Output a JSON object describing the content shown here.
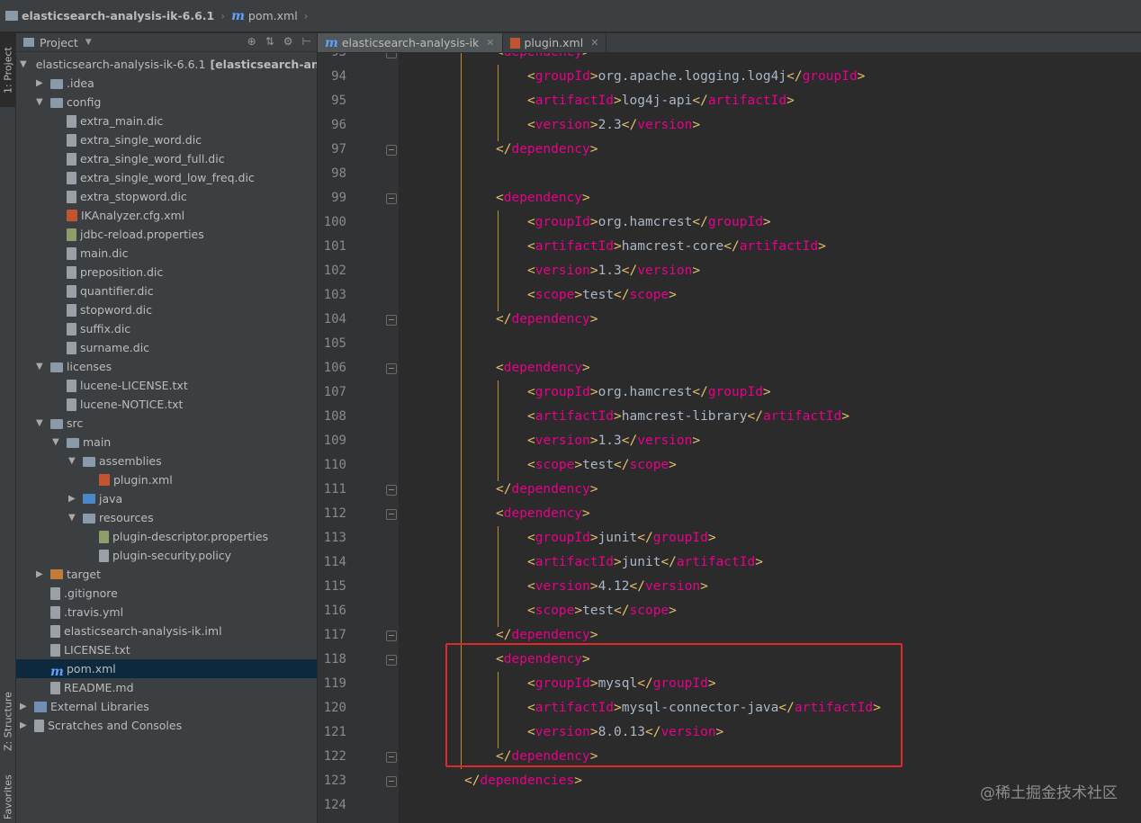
{
  "breadcrumb": {
    "project": "elasticsearch-analysis-ik-6.6.1",
    "file": "pom.xml"
  },
  "left_strip": {
    "project_tab": "1: Project",
    "structure_tab": "Z: Structure",
    "favorites_tab": "Favorites"
  },
  "project_panel": {
    "title": "Project",
    "items": [
      {
        "label": "elasticsearch-analysis-ik-6.6.1",
        "extra": "[elasticsearch-analy",
        "icon": "folder-icon",
        "arrow": "down"
      },
      {
        "label": ".idea",
        "icon": "folder-icon",
        "arrow": "right"
      },
      {
        "label": "config",
        "icon": "folder-icon",
        "arrow": "down"
      },
      {
        "label": "extra_main.dic",
        "icon": "file-icon",
        "arrow": ""
      },
      {
        "label": "extra_single_word.dic",
        "icon": "file-icon",
        "arrow": ""
      },
      {
        "label": "extra_single_word_full.dic",
        "icon": "file-icon",
        "arrow": ""
      },
      {
        "label": "extra_single_word_low_freq.dic",
        "icon": "file-icon",
        "arrow": ""
      },
      {
        "label": "extra_stopword.dic",
        "icon": "file-icon",
        "arrow": ""
      },
      {
        "label": "IKAnalyzer.cfg.xml",
        "icon": "xml-icon",
        "arrow": ""
      },
      {
        "label": "jdbc-reload.properties",
        "icon": "properties-icon",
        "arrow": ""
      },
      {
        "label": "main.dic",
        "icon": "file-icon",
        "arrow": ""
      },
      {
        "label": "preposition.dic",
        "icon": "file-icon",
        "arrow": ""
      },
      {
        "label": "quantifier.dic",
        "icon": "file-icon",
        "arrow": ""
      },
      {
        "label": "stopword.dic",
        "icon": "file-icon",
        "arrow": ""
      },
      {
        "label": "suffix.dic",
        "icon": "file-icon",
        "arrow": ""
      },
      {
        "label": "surname.dic",
        "icon": "file-icon",
        "arrow": ""
      },
      {
        "label": "licenses",
        "icon": "folder-icon",
        "arrow": "down"
      },
      {
        "label": "lucene-LICENSE.txt",
        "icon": "file-icon",
        "arrow": ""
      },
      {
        "label": "lucene-NOTICE.txt",
        "icon": "file-icon",
        "arrow": ""
      },
      {
        "label": "src",
        "icon": "folder-icon",
        "arrow": "down"
      },
      {
        "label": "main",
        "icon": "folder-icon",
        "arrow": "down"
      },
      {
        "label": "assemblies",
        "icon": "folder-icon",
        "arrow": "down"
      },
      {
        "label": "plugin.xml",
        "icon": "xml-icon",
        "arrow": ""
      },
      {
        "label": "java",
        "icon": "source-folder-icon",
        "arrow": "right"
      },
      {
        "label": "resources",
        "icon": "resources-folder-icon",
        "arrow": "down"
      },
      {
        "label": "plugin-descriptor.properties",
        "icon": "properties-icon",
        "arrow": ""
      },
      {
        "label": "plugin-security.policy",
        "icon": "file-icon",
        "arrow": ""
      },
      {
        "label": "target",
        "icon": "excluded-folder-icon",
        "arrow": "right"
      },
      {
        "label": ".gitignore",
        "icon": "file-icon",
        "arrow": ""
      },
      {
        "label": ".travis.yml",
        "icon": "file-icon",
        "arrow": ""
      },
      {
        "label": "elasticsearch-analysis-ik.iml",
        "icon": "file-icon",
        "arrow": ""
      },
      {
        "label": "LICENSE.txt",
        "icon": "file-icon",
        "arrow": ""
      },
      {
        "label": "pom.xml",
        "icon": "maven-icon",
        "arrow": "",
        "selected": true
      },
      {
        "label": "README.md",
        "icon": "file-icon",
        "arrow": ""
      },
      {
        "label": "External Libraries",
        "icon": "library-icon",
        "arrow": "right"
      },
      {
        "label": "Scratches and Consoles",
        "icon": "scratches-icon",
        "arrow": "right"
      }
    ]
  },
  "tabs": [
    {
      "label": "elasticsearch-analysis-ik",
      "icon": "maven-icon",
      "active": true
    },
    {
      "label": "plugin.xml",
      "icon": "xml-icon",
      "active": false
    }
  ],
  "editor": {
    "lines": [
      {
        "n": "93",
        "indent": 4,
        "tag": "dependency",
        "kind": "open-partial"
      },
      {
        "n": "94",
        "indent": 6,
        "tag": "groupId",
        "value": "org.apache.logging.log4j"
      },
      {
        "n": "95",
        "indent": 6,
        "tag": "artifactId",
        "value": "log4j-api"
      },
      {
        "n": "96",
        "indent": 6,
        "tag": "version",
        "value": "2.3"
      },
      {
        "n": "97",
        "indent": 4,
        "tag": "dependency",
        "kind": "close"
      },
      {
        "n": "98",
        "kind": "blank"
      },
      {
        "n": "99",
        "indent": 4,
        "tag": "dependency",
        "kind": "open"
      },
      {
        "n": "100",
        "indent": 6,
        "tag": "groupId",
        "value": "org.hamcrest"
      },
      {
        "n": "101",
        "indent": 6,
        "tag": "artifactId",
        "value": "hamcrest-core"
      },
      {
        "n": "102",
        "indent": 6,
        "tag": "version",
        "value": "1.3"
      },
      {
        "n": "103",
        "indent": 6,
        "tag": "scope",
        "value": "test"
      },
      {
        "n": "104",
        "indent": 4,
        "tag": "dependency",
        "kind": "close"
      },
      {
        "n": "105",
        "kind": "blank"
      },
      {
        "n": "106",
        "indent": 4,
        "tag": "dependency",
        "kind": "open"
      },
      {
        "n": "107",
        "indent": 6,
        "tag": "groupId",
        "value": "org.hamcrest"
      },
      {
        "n": "108",
        "indent": 6,
        "tag": "artifactId",
        "value": "hamcrest-library"
      },
      {
        "n": "109",
        "indent": 6,
        "tag": "version",
        "value": "1.3"
      },
      {
        "n": "110",
        "indent": 6,
        "tag": "scope",
        "value": "test"
      },
      {
        "n": "111",
        "indent": 4,
        "tag": "dependency",
        "kind": "close"
      },
      {
        "n": "112",
        "indent": 4,
        "tag": "dependency",
        "kind": "open"
      },
      {
        "n": "113",
        "indent": 6,
        "tag": "groupId",
        "value": "junit"
      },
      {
        "n": "114",
        "indent": 6,
        "tag": "artifactId",
        "value": "junit"
      },
      {
        "n": "115",
        "indent": 6,
        "tag": "version",
        "value": "4.12"
      },
      {
        "n": "116",
        "indent": 6,
        "tag": "scope",
        "value": "test"
      },
      {
        "n": "117",
        "indent": 4,
        "tag": "dependency",
        "kind": "close"
      },
      {
        "n": "118",
        "indent": 4,
        "tag": "dependency",
        "kind": "open"
      },
      {
        "n": "119",
        "indent": 6,
        "tag": "groupId",
        "value": "mysql"
      },
      {
        "n": "120",
        "indent": 6,
        "tag": "artifactId",
        "value": "mysql-connector-java"
      },
      {
        "n": "121",
        "indent": 6,
        "tag": "version",
        "value": "8.0.13"
      },
      {
        "n": "122",
        "indent": 4,
        "tag": "dependency",
        "kind": "close"
      },
      {
        "n": "123",
        "indent": 2,
        "tag": "dependencies",
        "kind": "close"
      },
      {
        "n": "124",
        "kind": "blank"
      }
    ]
  },
  "watermark": "@稀土掘金技术社区",
  "colors": {
    "tag_bracket": "#e8bf6a",
    "tag_name": "#e8008a",
    "text": "#a9b7c6",
    "highlight_box": "#e02828"
  }
}
